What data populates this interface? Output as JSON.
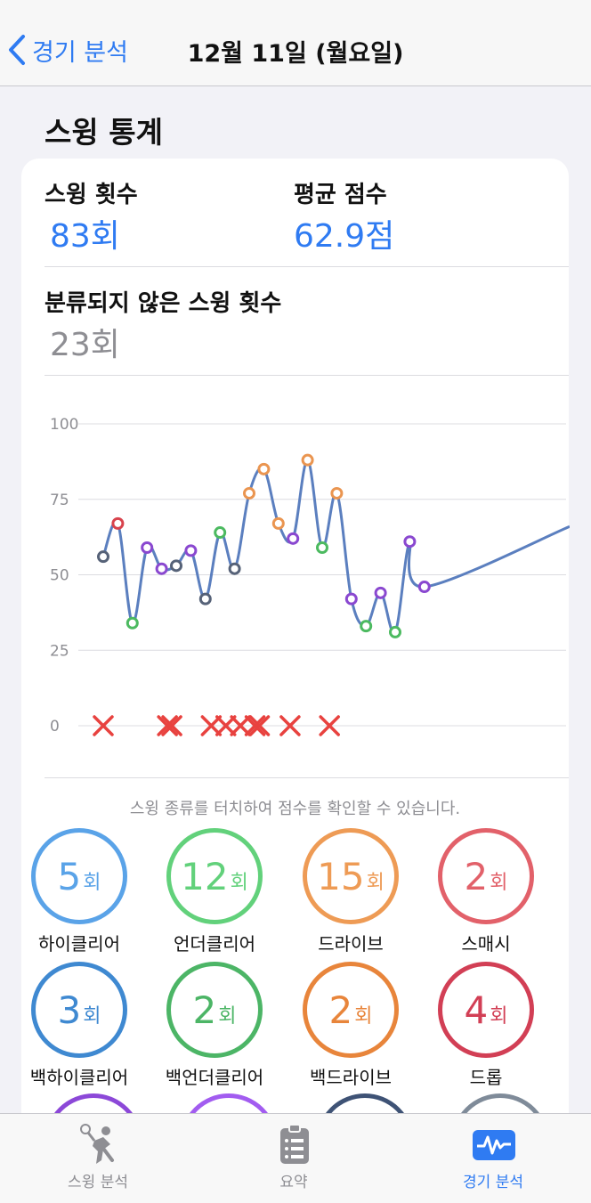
{
  "nav": {
    "back_label": "경기 분석",
    "title": "12월 11일 (월요일)"
  },
  "section_title": "스윙 통계",
  "stats": {
    "swing_count_label": "스윙 횟수",
    "swing_count_value": "83회",
    "avg_score_label": "평균 점수",
    "avg_score_value": "62.9점",
    "unclassified_label": "분류되지 않은 스윙 횟수",
    "unclassified_value": "23회"
  },
  "chart_data": {
    "type": "line",
    "y_ticks": [
      "0",
      "25",
      "50",
      "75",
      "100"
    ],
    "ylim": [
      0,
      100
    ],
    "grid": true,
    "points": [
      {
        "v": 56,
        "t": "other"
      },
      {
        "v": 67,
        "t": "smash"
      },
      {
        "v": 34,
        "t": "under"
      },
      {
        "v": 59,
        "t": "purple"
      },
      {
        "v": 52,
        "t": "purple"
      },
      {
        "v": 53,
        "t": "other"
      },
      {
        "v": 58,
        "t": "purple"
      },
      {
        "v": 42,
        "t": "other"
      },
      {
        "v": 64,
        "t": "under"
      },
      {
        "v": 52,
        "t": "other"
      },
      {
        "v": 77,
        "t": "drive"
      },
      {
        "v": 85,
        "t": "drive"
      },
      {
        "v": 67,
        "t": "drive"
      },
      {
        "v": 62,
        "t": "purple"
      },
      {
        "v": 88,
        "t": "drive"
      },
      {
        "v": 59,
        "t": "under"
      },
      {
        "v": 77,
        "t": "drive"
      },
      {
        "v": 42,
        "t": "purple"
      },
      {
        "v": 33,
        "t": "under"
      },
      {
        "v": 44,
        "t": "purple"
      },
      {
        "v": 31,
        "t": "under"
      },
      {
        "v": 61,
        "t": "purple"
      },
      {
        "v": 46,
        "t": "purple"
      }
    ],
    "misses": [
      0,
      4.4,
      4.7,
      7.4,
      8.4,
      9.4,
      10.4,
      10.7,
      12.8,
      15.5
    ]
  },
  "hint": "스윙 종류를 터치하여 점수를 확인할 수 있습니다.",
  "badges": [
    {
      "count": "5",
      "unit": "회",
      "label": "하이클리어",
      "color": "#5aa3e8"
    },
    {
      "count": "12",
      "unit": "회",
      "label": "언더클리어",
      "color": "#62d17b"
    },
    {
      "count": "15",
      "unit": "회",
      "label": "드라이브",
      "color": "#ee9b55"
    },
    {
      "count": "2",
      "unit": "회",
      "label": "스매시",
      "color": "#e2616a"
    },
    {
      "count": "3",
      "unit": "회",
      "label": "백하이클리어",
      "color": "#3f89d1"
    },
    {
      "count": "2",
      "unit": "회",
      "label": "백언더클리어",
      "color": "#4cb566"
    },
    {
      "count": "2",
      "unit": "회",
      "label": "백드라이브",
      "color": "#e8853b"
    },
    {
      "count": "4",
      "unit": "회",
      "label": "드롭",
      "color": "#d23f55"
    }
  ],
  "partial_badges": [
    {
      "color": "#8c48d8"
    },
    {
      "color": "#a25cf0"
    },
    {
      "color": "#3e5275"
    },
    {
      "color": "#7f8b99"
    }
  ],
  "colors": {
    "accent": "#2f7bf2",
    "line": "#5b7fbf",
    "miss": "#e8423f",
    "other": "#566278",
    "purple": "#8a48d0",
    "under": "#4cba60",
    "drive": "#ea9550",
    "smash": "#d8434d"
  },
  "tabs": [
    {
      "label": "스윙 분석",
      "icon": "badminton-player-icon",
      "active": false
    },
    {
      "label": "요약",
      "icon": "clipboard-list-icon",
      "active": false
    },
    {
      "label": "경기 분석",
      "icon": "pulse-chart-icon",
      "active": true
    }
  ]
}
